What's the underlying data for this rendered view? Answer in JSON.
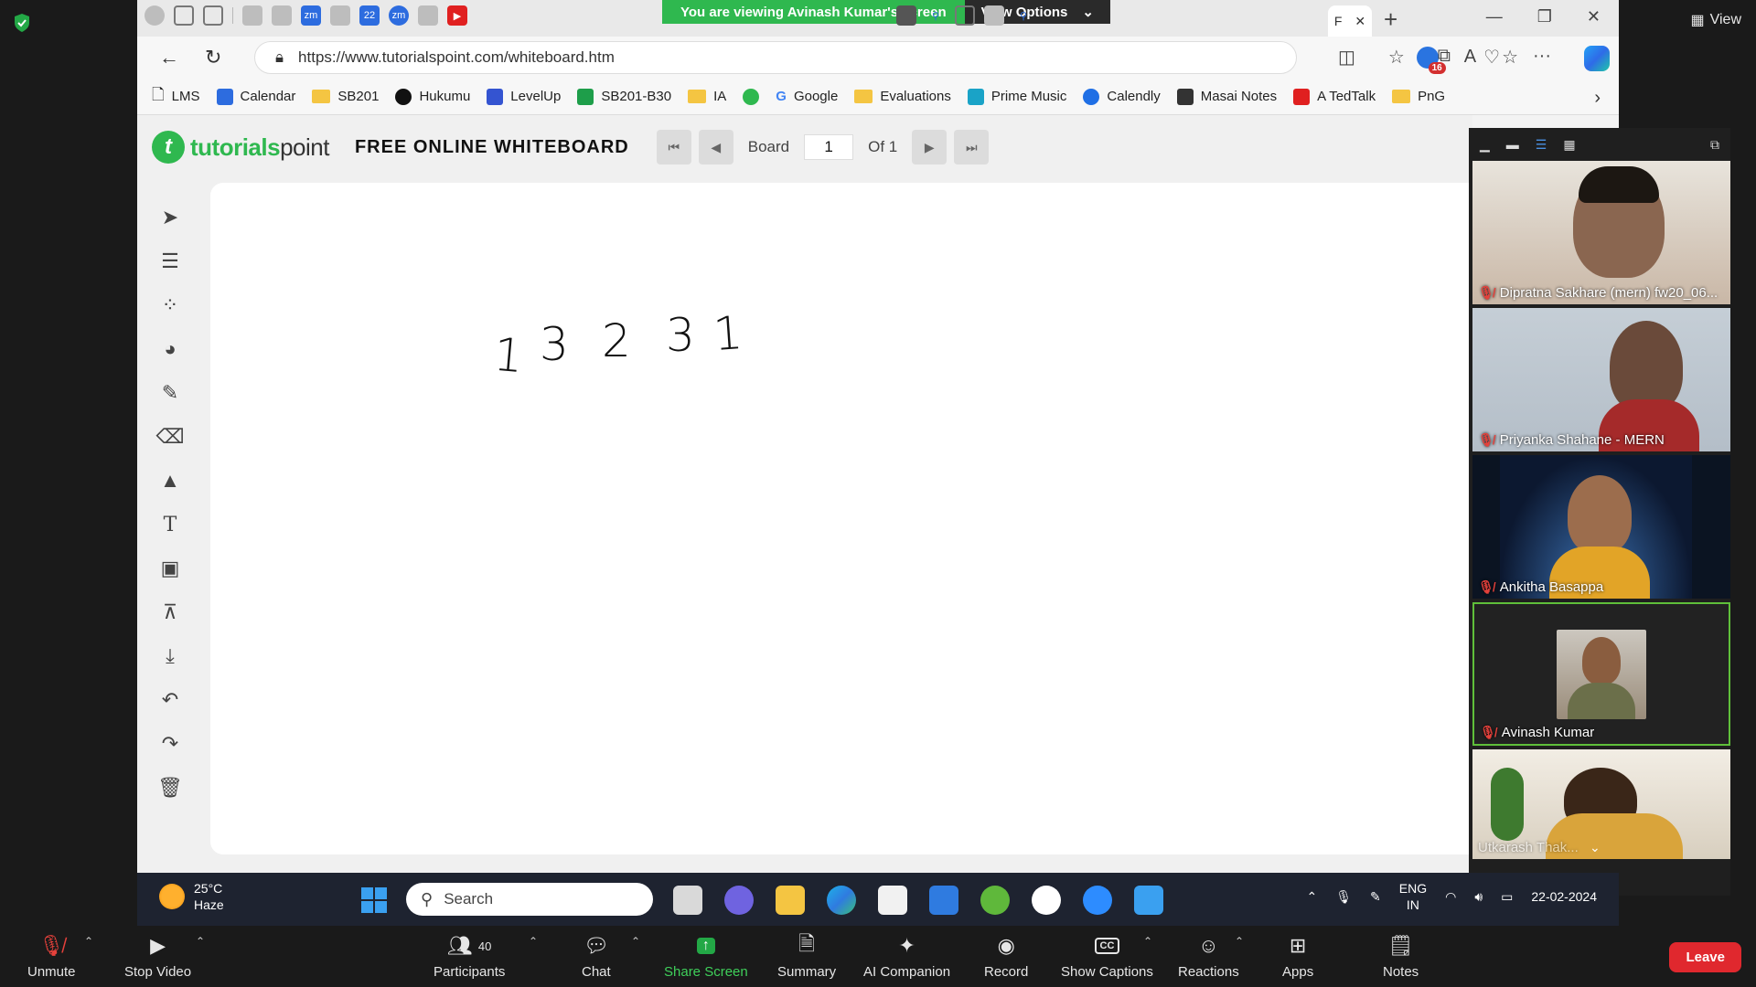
{
  "zoom": {
    "view_label": "View",
    "banner_text": "You are viewing Avinash Kumar's screen",
    "view_options_label": "View Options",
    "leave_label": "Leave",
    "toolbar": {
      "unmute": "Unmute",
      "stop_video": "Stop Video",
      "participants": "Participants",
      "participants_count": "40",
      "chat": "Chat",
      "share_screen": "Share Screen",
      "summary": "Summary",
      "ai_companion": "AI Companion",
      "record": "Record",
      "show_captions": "Show Captions",
      "reactions": "Reactions",
      "apps": "Apps",
      "notes": "Notes"
    },
    "participants": [
      {
        "name": "Dipratna Sakhare (mern) fw20_06..."
      },
      {
        "name": "Priyanka Shahane - MERN"
      },
      {
        "name": "Ankitha Basappa"
      },
      {
        "name": "Avinash Kumar"
      },
      {
        "name": "Utkarash Thak..."
      }
    ]
  },
  "browser": {
    "url": "https://www.tutorialspoint.com/whiteboard.htm",
    "notification_count": "16",
    "bookmarks": [
      "LMS",
      "Calendar",
      "SB201",
      "Hukumu",
      "LevelUp",
      "SB201-B30",
      "IA",
      "Google",
      "Evaluations",
      "Prime Music",
      "Calendly",
      "Masai Notes",
      "A TedTalk",
      "PnG"
    ]
  },
  "page": {
    "logo_text_green": "tutorials",
    "logo_text_dark": "point",
    "title": "FREE ONLINE WHITEBOARD",
    "board_label": "Board",
    "board_number": "1",
    "board_of": "Of 1",
    "canvas_digits": [
      "1",
      "3",
      "2",
      "3",
      "1"
    ]
  },
  "taskbar": {
    "temperature": "25°C",
    "weather": "Haze",
    "search_placeholder": "Search",
    "lang_top": "ENG",
    "lang_bottom": "IN",
    "date": "22-02-2024"
  }
}
